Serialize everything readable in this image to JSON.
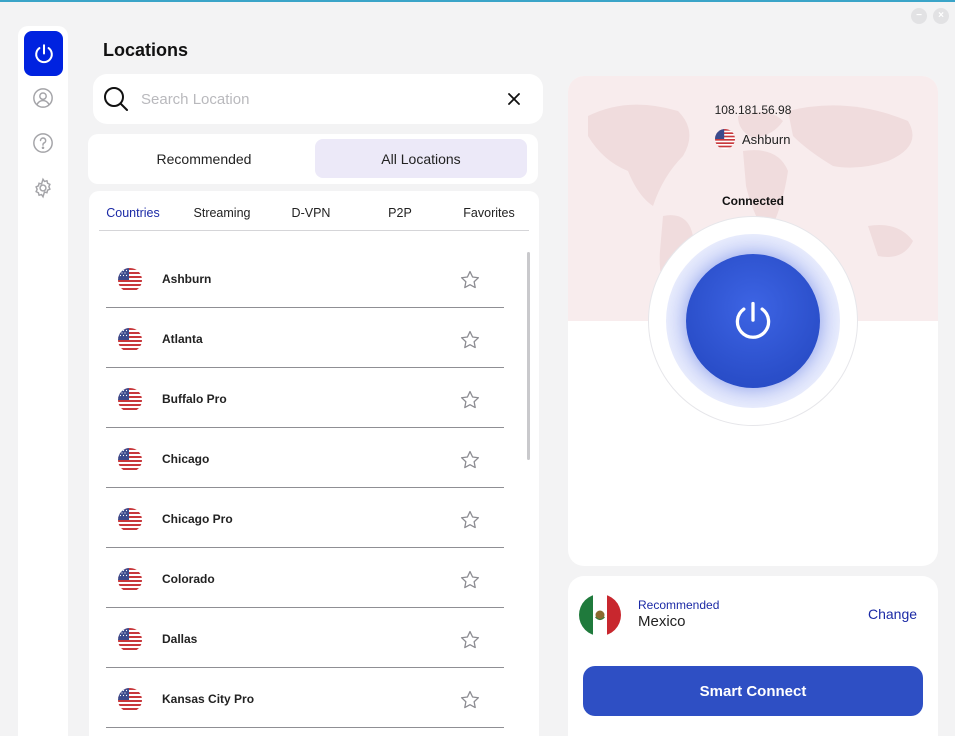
{
  "window": {
    "minimize_glyph": "−",
    "close_glyph": "×"
  },
  "sidebar": {
    "items": [
      {
        "name": "power",
        "icon": "power-icon",
        "active": true
      },
      {
        "name": "account",
        "icon": "user-icon",
        "active": false
      },
      {
        "name": "help",
        "icon": "help-icon",
        "active": false
      },
      {
        "name": "settings",
        "icon": "gear-icon",
        "active": false
      }
    ]
  },
  "page": {
    "title": "Locations"
  },
  "search": {
    "placeholder": "Search Location",
    "value": ""
  },
  "segments": {
    "recommended": "Recommended",
    "all": "All Locations",
    "selected": "All Locations"
  },
  "subtabs": {
    "items": [
      "Countries",
      "Streaming",
      "D-VPN",
      "P2P",
      "Favorites"
    ],
    "active": "Countries"
  },
  "locations": [
    {
      "name": "Ashburn",
      "flag": "us-flag",
      "favorite": false
    },
    {
      "name": "Atlanta",
      "flag": "us-flag",
      "favorite": false
    },
    {
      "name": "Buffalo Pro",
      "flag": "us-flag",
      "favorite": false
    },
    {
      "name": "Chicago",
      "flag": "us-flag",
      "favorite": false
    },
    {
      "name": "Chicago Pro",
      "flag": "us-flag",
      "favorite": false
    },
    {
      "name": "Colorado",
      "flag": "us-flag",
      "favorite": false
    },
    {
      "name": "Dallas",
      "flag": "us-flag",
      "favorite": false
    },
    {
      "name": "Kansas City Pro",
      "flag": "us-flag",
      "favorite": false
    }
  ],
  "status": {
    "ip": "108.181.56.98",
    "location": "Ashburn",
    "state": "Connected"
  },
  "recommended": {
    "label": "Recommended",
    "country": "Mexico",
    "flag": "mexico-flag",
    "change_label": "Change"
  },
  "smart_connect": {
    "label": "Smart Connect"
  },
  "colors": {
    "accent": "#2e4fc4",
    "sidebar_active": "#0022e0",
    "link": "#1b2aa6",
    "map_tint": "#f8eced"
  }
}
